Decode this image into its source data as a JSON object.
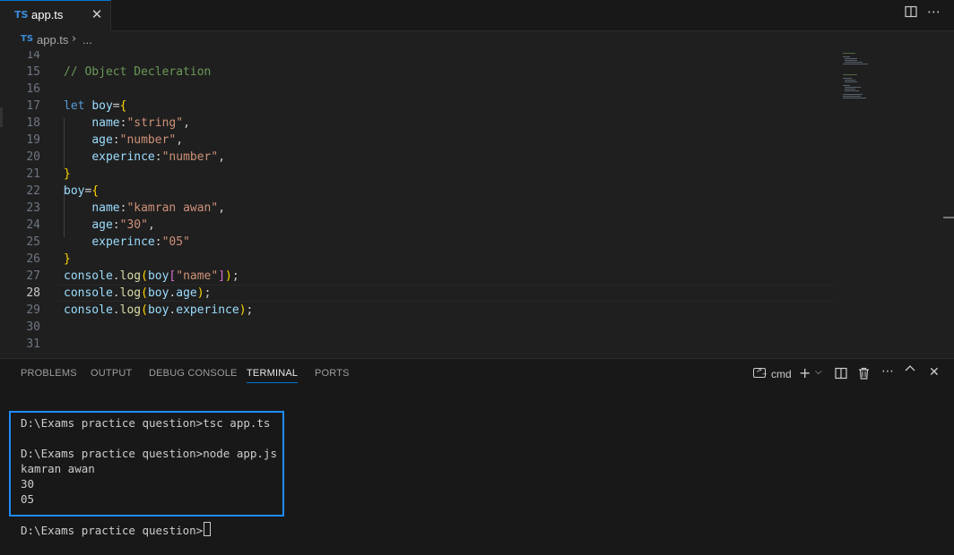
{
  "tab": {
    "lang_badge": "TS",
    "title": "app.ts",
    "close": "✕"
  },
  "breadcrumb": {
    "lang_badge": "TS",
    "file": "app.ts",
    "separator": "›",
    "more": "..."
  },
  "editor": {
    "lines": [
      {
        "n": "14"
      },
      {
        "n": "15"
      },
      {
        "n": "16"
      },
      {
        "n": "17"
      },
      {
        "n": "18"
      },
      {
        "n": "19"
      },
      {
        "n": "20"
      },
      {
        "n": "21"
      },
      {
        "n": "22"
      },
      {
        "n": "23"
      },
      {
        "n": "24"
      },
      {
        "n": "25"
      },
      {
        "n": "26"
      },
      {
        "n": "27"
      },
      {
        "n": "28"
      },
      {
        "n": "29"
      },
      {
        "n": "30"
      },
      {
        "n": "31"
      }
    ],
    "code": {
      "l15": "// Object Decleration",
      "l17_kw": "let",
      "l17_var": "boy",
      "l18_key": "name",
      "l18_val": "\"string\"",
      "l19_key": "age",
      "l19_val": "\"number\"",
      "l20_key": "experince",
      "l20_val": "\"number\"",
      "l22_var": "boy",
      "l23_key": "name",
      "l23_val": "\"kamran awan\"",
      "l24_key": "age",
      "l24_val": "\"30\"",
      "l25_key": "experince",
      "l25_val": "\"05\"",
      "console": "console",
      "log": "log",
      "boy": "boy",
      "l27_str": "\"name\"",
      "l28_prop": "age",
      "l29_prop": "experince"
    }
  },
  "panel": {
    "tabs": [
      "PROBLEMS",
      "OUTPUT",
      "DEBUG CONSOLE",
      "TERMINAL",
      "PORTS"
    ],
    "active_tab": "TERMINAL",
    "shell_label": "cmd",
    "terminal_lines": [
      "D:\\Exams practice question>tsc app.ts",
      "D:\\Exams practice question>node app.js",
      "kamran awan",
      "30",
      "05",
      "D:\\Exams practice question>"
    ]
  }
}
